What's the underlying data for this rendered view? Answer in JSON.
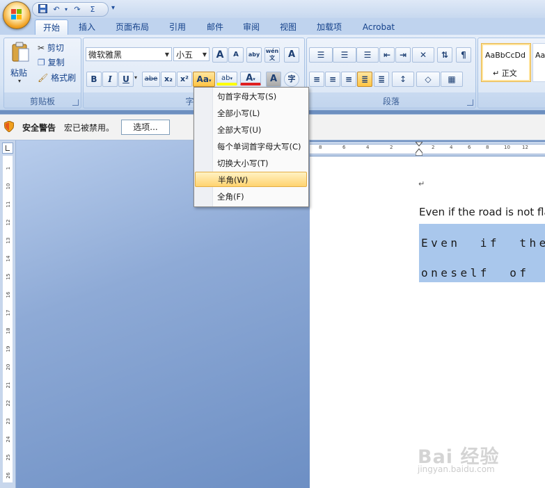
{
  "quick_access": {
    "save": "save-icon",
    "undo": "↶",
    "redo": "↷",
    "sigma": "Σ",
    "customize": "▾"
  },
  "tabs": [
    "开始",
    "插入",
    "页面布局",
    "引用",
    "邮件",
    "审阅",
    "视图",
    "加载项",
    "Acrobat"
  ],
  "active_tab": "开始",
  "clipboard": {
    "paste": "粘贴",
    "cut": "剪切",
    "copy": "复制",
    "format_painter": "格式刷",
    "label": "剪贴板"
  },
  "font_group": {
    "font_name": "微软雅黑",
    "font_size": "小五",
    "grow": "A",
    "shrink": "A",
    "clear": "aby",
    "pinyin": "wén 文",
    "border_char": "A",
    "bold": "B",
    "italic": "I",
    "underline": "U",
    "strike": "abe",
    "subscript": "x₂",
    "superscript": "x²",
    "change_case": "Aa",
    "highlight": "ab",
    "font_color": "A",
    "shading": "A",
    "enclose": "字",
    "label": "字体"
  },
  "paragraph_group": {
    "label": "段落"
  },
  "styles_group": {
    "normal_preview": "AaBbCcDd",
    "normal_label": "↵ 正文",
    "next_preview": "Aa"
  },
  "security": {
    "title": "安全警告",
    "message": "宏已被禁用。",
    "options_button": "选项..."
  },
  "case_menu": [
    {
      "label": "句首字母大写(S)",
      "highlighted": false
    },
    {
      "label": "全部小写(L)",
      "highlighted": false
    },
    {
      "label": "全部大写(U)",
      "highlighted": false
    },
    {
      "label": "每个单词首字母大写(C)",
      "highlighted": false
    },
    {
      "label": "切换大小写(T)",
      "highlighted": false
    },
    {
      "label": "半角(W)",
      "highlighted": true
    },
    {
      "label": "全角(F)",
      "highlighted": false
    }
  ],
  "document": {
    "para_mark": "↵",
    "line1": "Even if the road is not fla",
    "line2": "Even  if  the",
    "line3": "oneself  of  t"
  },
  "vruler_numbers": [
    "1",
    "10",
    "11",
    "12",
    "13",
    "14",
    "15",
    "16",
    "17",
    "18",
    "19",
    "20",
    "21",
    "22",
    "23",
    "24",
    "25",
    "26"
  ],
  "hruler_numbers": [
    "8",
    "6",
    "4",
    "2",
    "2",
    "4",
    "6",
    "8",
    "10",
    "12"
  ],
  "colors": {
    "accent": "#15428b",
    "ribbon": "#dbe6f5",
    "menu_highlight": "#ffd36f",
    "selection": "#a9c7ec",
    "workspace": "#6d8fc0"
  },
  "watermark": {
    "logo": "Bai 经验",
    "url": "jingyan.baidu.com"
  }
}
